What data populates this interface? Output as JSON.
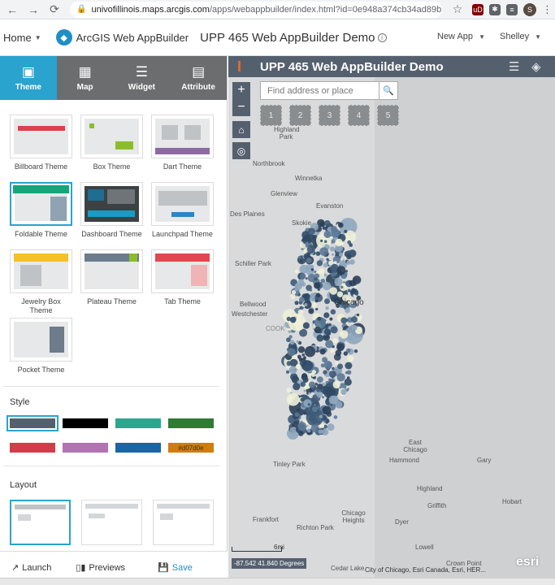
{
  "browser": {
    "url_host": "univofillinois.maps.arcgis.com",
    "url_path": "/apps/webappbuilder/index.html?id=0e948a374cb34ad89b3...",
    "avatar_letter": "S",
    "ext1": "uD",
    "ext2": "✱",
    "ext3": "≡"
  },
  "header": {
    "home_label": "Home",
    "builder_name": "ArcGIS Web AppBuilder",
    "app_title": "UPP 465 Web AppBuilder Demo",
    "new_app_label": "New App",
    "user_label": "Shelley"
  },
  "tabs": [
    {
      "label": "Theme",
      "icon": "theme-icon"
    },
    {
      "label": "Map",
      "icon": "map-icon"
    },
    {
      "label": "Widget",
      "icon": "widget-icon"
    },
    {
      "label": "Attribute",
      "icon": "attribute-icon"
    }
  ],
  "themes": [
    {
      "label": "Billboard Theme",
      "accent": "#d9424b"
    },
    {
      "label": "Box Theme",
      "accent": "#8bbd2a"
    },
    {
      "label": "Dart Theme",
      "accent": "#8e6aa3"
    },
    {
      "label": "Foldable Theme",
      "accent": "#17a578",
      "selected": true
    },
    {
      "label": "Dashboard Theme",
      "accent": "#3c4143"
    },
    {
      "label": "Launchpad Theme",
      "accent": "#2d86c5"
    },
    {
      "label": "Jewelry Box Theme",
      "accent": "#f5c12a"
    },
    {
      "label": "Plateau Theme",
      "accent": "#8bbd2a"
    },
    {
      "label": "Tab Theme",
      "accent": "#e1474e"
    },
    {
      "label": "Pocket Theme",
      "accent": "#6d7b8a"
    }
  ],
  "style": {
    "label": "Style",
    "swatches": [
      "#55606f",
      "#000000",
      "#2aa78e",
      "#2e7b33",
      "#d43c49",
      "#b173b2",
      "#1965a6",
      "#d07d0e"
    ],
    "custom_label": "#d07d0e",
    "selected_index": 0
  },
  "layout": {
    "label": "Layout"
  },
  "bottom": {
    "launch": "Launch",
    "previews": "Previews",
    "save": "Save"
  },
  "map": {
    "title": "UPP 465 Web AppBuilder Demo",
    "search_placeholder": "Find address or place",
    "bookmarks": [
      "1",
      "2",
      "3",
      "4",
      "5"
    ],
    "scale_label": "6mi",
    "coords": "-87.542 41.840 Degrees",
    "attribution": "City of Chicago, Esri Canada, Esri, HER...",
    "esri": "esri",
    "places": [
      {
        "name": "Highland Park"
      },
      {
        "name": "Northbrook"
      },
      {
        "name": "Winnetka"
      },
      {
        "name": "Glenview"
      },
      {
        "name": "Evanston"
      },
      {
        "name": "Des Plaines"
      },
      {
        "name": "Skokie"
      },
      {
        "name": "Schiller Park"
      },
      {
        "name": "Chicago"
      },
      {
        "name": "Bellwood"
      },
      {
        "name": "Westchester"
      },
      {
        "name": "COOK"
      },
      {
        "name": "East Chicago"
      },
      {
        "name": "Tinley Park"
      },
      {
        "name": "Hammond"
      },
      {
        "name": "Gary"
      },
      {
        "name": "Highland"
      },
      {
        "name": "Griffith"
      },
      {
        "name": "Hobart"
      },
      {
        "name": "Frankfort"
      },
      {
        "name": "Chicago Heights"
      },
      {
        "name": "Dyer"
      },
      {
        "name": "Richton Park"
      },
      {
        "name": "Lowell"
      },
      {
        "name": "Crown Point"
      },
      {
        "name": "Cedar Lake"
      }
    ]
  }
}
